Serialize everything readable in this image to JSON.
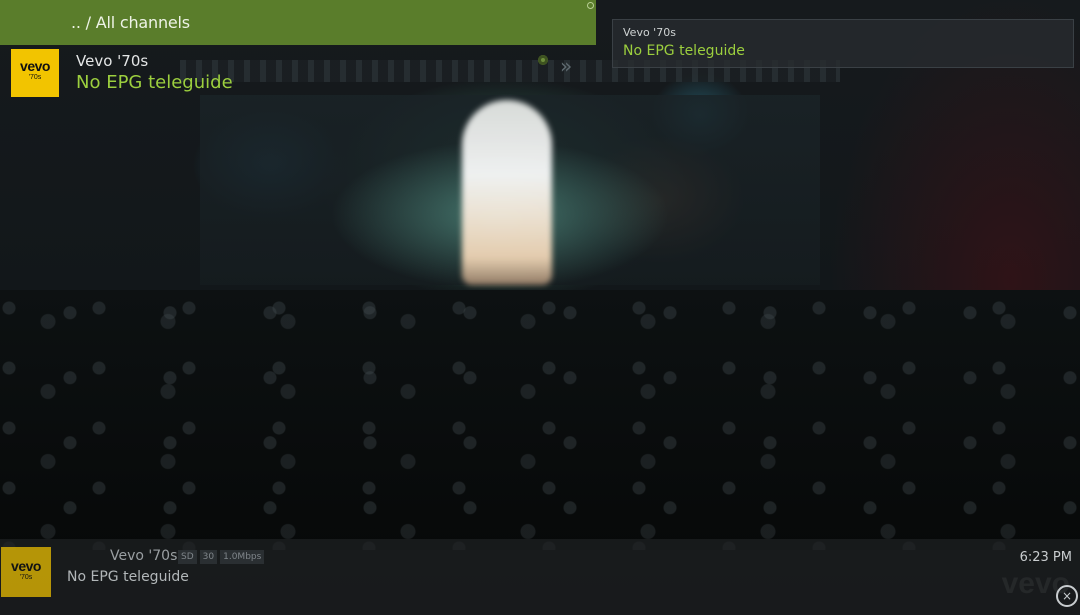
{
  "header": {
    "breadcrumb": ".. / All channels"
  },
  "channel_list": {
    "items": [
      {
        "logo": {
          "brand": "vevo",
          "sub": "'70s"
        },
        "name": "Vevo '70s",
        "program": "No EPG teleguide",
        "chevron": "»"
      }
    ]
  },
  "info_box": {
    "name": "Vevo '70s",
    "program": "No EPG teleguide"
  },
  "osd": {
    "logo": {
      "brand": "vevo",
      "sub": "'70s"
    },
    "channel_name": "Vevo '70s",
    "badges": [
      "SD",
      "30",
      "1.0Mbps"
    ],
    "program": "No EPG teleguide",
    "time": "6:23 PM",
    "watermark": "vevo",
    "close_icon": "×"
  },
  "colors": {
    "header_green": "#5a7d2b",
    "program_green": "#9ccf3e",
    "logo_yellow": "#f2c400"
  },
  "icons": [
    "record-dot-icon",
    "double-chevron-right-icon",
    "close-circle-icon"
  ]
}
